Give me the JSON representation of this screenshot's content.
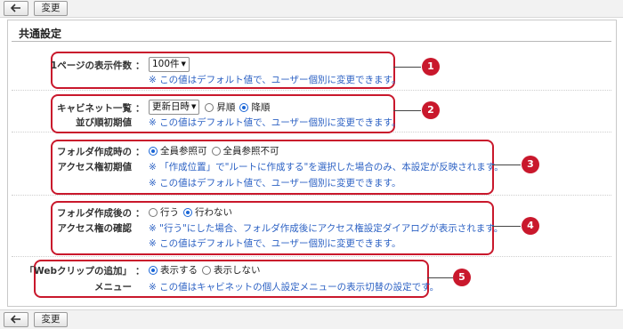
{
  "toolbar": {
    "change_label": "変更"
  },
  "section": {
    "title": "共通設定"
  },
  "rows": {
    "r1": {
      "label": "1ページの表示件数",
      "select_value": "100件",
      "note": "※ この値はデフォルト値で、ユーザー個別に変更できます。",
      "badge": "1"
    },
    "r2": {
      "label_line1": "キャビネット一覧",
      "label_line2": "並び順初期値",
      "select_value": "更新日時",
      "opt1": "昇順",
      "opt2": "降順",
      "note": "※ この値はデフォルト値で、ユーザー個別に変更できます。",
      "badge": "2"
    },
    "r3": {
      "label_line1": "フォルダ作成時の",
      "label_line2": "アクセス権初期値",
      "opt1": "全員参照可",
      "opt2": "全員参照不可",
      "note1": "※ 「作成位置」で\"ルートに作成する\"を選択した場合のみ、本設定が反映されます。",
      "note2": "※ この値はデフォルト値で、ユーザー個別に変更できます。",
      "badge": "3"
    },
    "r4": {
      "label_line1": "フォルダ作成後の",
      "label_line2": "アクセス権の確認",
      "opt1": "行う",
      "opt2": "行わない",
      "note1": "※ \"行う\"にした場合、フォルダ作成後にアクセス権設定ダイアログが表示されます。",
      "note2": "※ この値はデフォルト値で、ユーザー個別に変更できます。",
      "badge": "4"
    },
    "r5": {
      "label_line1": "「Webクリップの追加」",
      "label_line2": "メニュー",
      "opt1": "表示する",
      "opt2": "表示しない",
      "note": "※ この値はキャビネットの個人設定メニューの表示切替の設定です。",
      "badge": "5"
    }
  },
  "colon": "：",
  "colors": {
    "accent": "#c9182c",
    "note": "#2d62c4"
  }
}
